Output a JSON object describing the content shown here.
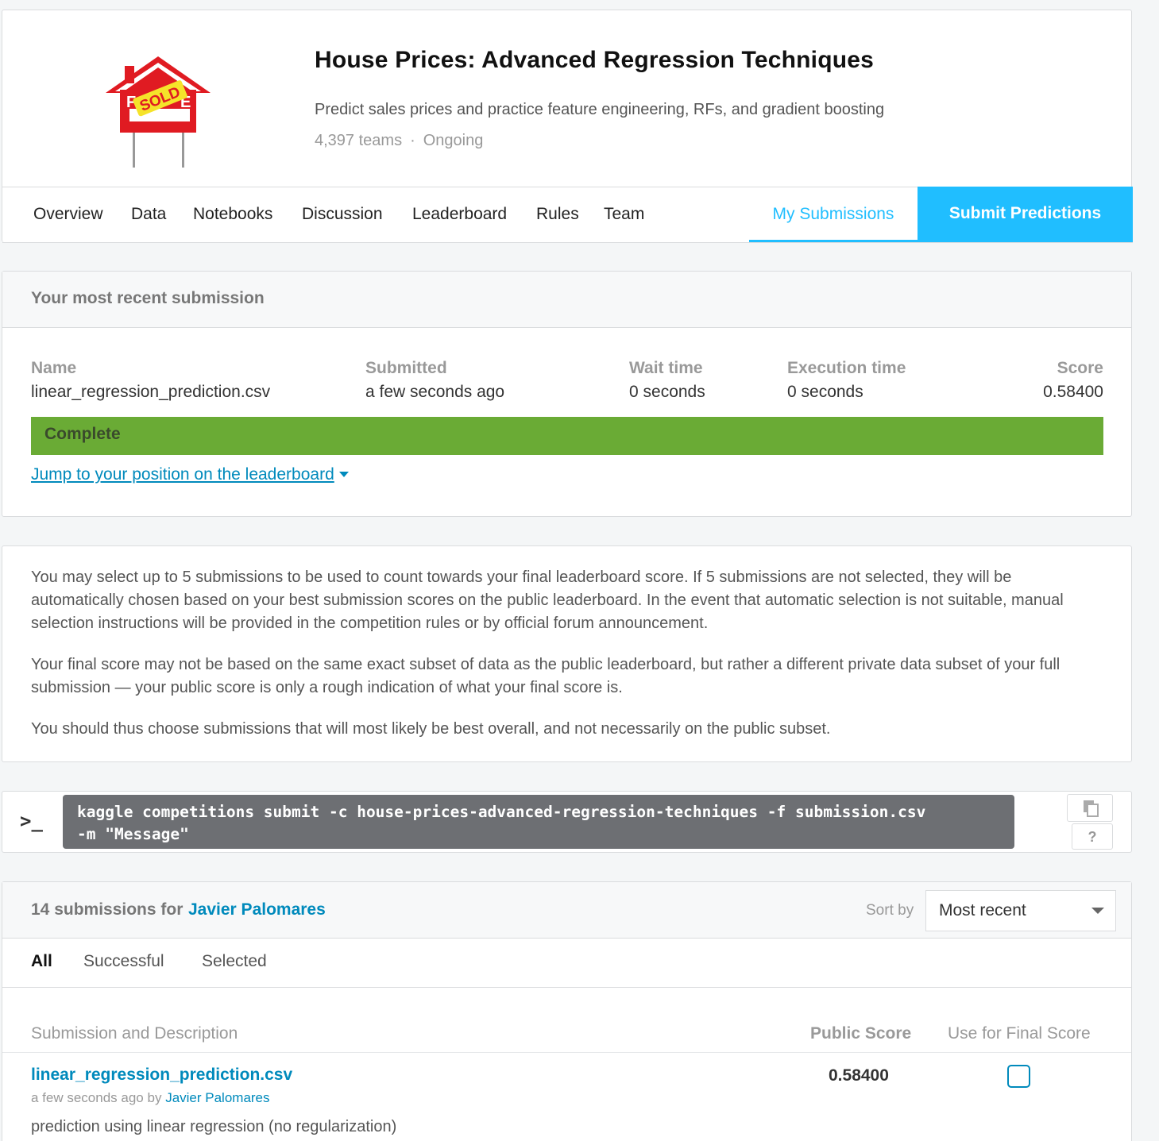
{
  "competition": {
    "title": "House Prices: Advanced Regression Techniques",
    "description": "Predict sales prices and practice feature engineering, RFs, and gradient boosting",
    "teams": "4,397 teams",
    "separator": "·",
    "status": "Ongoing",
    "logo_sign": "SOLD",
    "logo_partial": "E"
  },
  "tabs": [
    "Overview",
    "Data",
    "Notebooks",
    "Discussion",
    "Leaderboard",
    "Rules",
    "Team"
  ],
  "my_submissions_label": "My Submissions",
  "submit_label": "Submit Predictions",
  "recent": {
    "heading": "Your most recent submission",
    "columns": {
      "name": {
        "label": "Name",
        "value": "linear_regression_prediction.csv"
      },
      "submitted": {
        "label": "Submitted",
        "value": "a few seconds ago"
      },
      "wait": {
        "label": "Wait time",
        "value": "0 seconds"
      },
      "execution": {
        "label": "Execution time",
        "value": "0 seconds"
      },
      "score": {
        "label": "Score",
        "value": "0.58400"
      }
    },
    "status": "Complete",
    "jump_link": "Jump to your position on the leaderboard"
  },
  "info": {
    "p1": "You may select up to 5 submissions to be used to count towards your final leaderboard score. If 5 submissions are not selected, they will be automatically chosen based on your best submission scores on the public leaderboard. In the event that automatic selection is not suitable, manual selection instructions will be provided in the competition rules or by official forum announcement.",
    "p2": "Your final score may not be based on the same exact subset of data as the public leaderboard, but rather a different private data subset of your full submission — your public score is only a rough indication of what your final score is.",
    "p3": "You should thus choose submissions that will most likely be best overall, and not necessarily on the public subset."
  },
  "cli": {
    "prompt": ">_",
    "line1": "kaggle competitions submit -c house-prices-advanced-regression-techniques -f submission.csv",
    "line2": "-m \"Message\"",
    "help": "?"
  },
  "submissions": {
    "count_label": "14 submissions for",
    "user": "Javier Palomares",
    "sort_label": "Sort by",
    "sort_value": "Most recent",
    "filters": [
      "All",
      "Successful",
      "Selected"
    ],
    "headers": {
      "description": "Submission and Description",
      "public_score": "Public Score",
      "final": "Use for Final Score"
    },
    "rows": [
      {
        "file": "linear_regression_prediction.csv",
        "time": "a few seconds ago by",
        "user": "Javier Palomares",
        "description": "prediction using linear regression (no regularization)",
        "score": "0.58400",
        "selected": false
      }
    ]
  },
  "colors": {
    "accent": "#20beff",
    "link": "#008abc",
    "complete": "#6aab35",
    "house_red": "#e01b22",
    "sign_yellow": "#f5e32a"
  }
}
